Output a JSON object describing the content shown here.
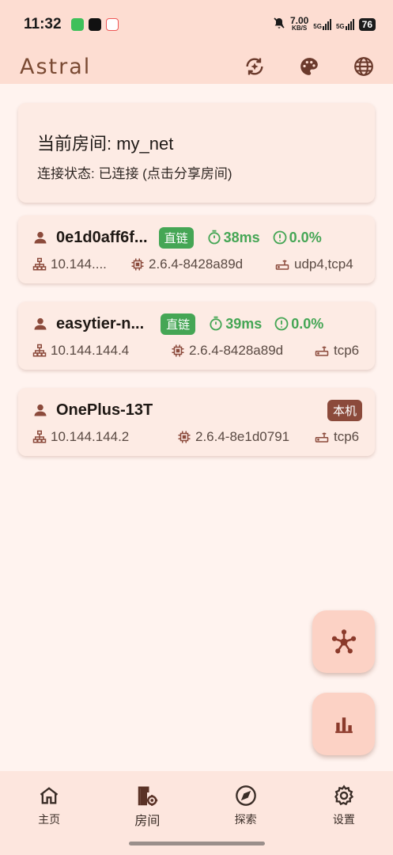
{
  "status_bar": {
    "time": "11:32",
    "net_speed_value": "7.00",
    "net_speed_unit": "KB/S",
    "signal1": "5G",
    "signal2": "5G",
    "battery": "76",
    "app_icons": [
      "wechat-icon",
      "tiktok-icon",
      "oppo-app-icon"
    ]
  },
  "app_bar": {
    "title": "Astral",
    "actions": [
      "sync-icon",
      "palette-icon",
      "globe-icon"
    ]
  },
  "room": {
    "name": "当前房间: my_net",
    "status": "连接状态: 已连接 (点击分享房间)"
  },
  "peers": [
    {
      "name": "0e1d0aff6f...",
      "badge": "直链",
      "latency": "38ms",
      "loss": "0.0%",
      "ip": "10.144....",
      "version": "2.6.4-8428a89d",
      "protocol": "udp4,tcp4"
    },
    {
      "name": "easytier-n...",
      "badge": "直链",
      "latency": "39ms",
      "loss": "0.0%",
      "ip": "10.144.144.4",
      "version": "2.6.4-8428a89d",
      "protocol": "tcp6"
    },
    {
      "name": "OnePlus-13T",
      "badge": "本机",
      "ip": "10.144.144.2",
      "version": "2.6.4-8e1d0791",
      "protocol": "tcp6"
    }
  ],
  "bottom_nav": [
    {
      "label": "主页",
      "icon": "home-icon"
    },
    {
      "label": "房间",
      "icon": "room-door-icon",
      "active": true
    },
    {
      "label": "探索",
      "icon": "compass-icon"
    },
    {
      "label": "设置",
      "icon": "gear-icon"
    }
  ],
  "colors": {
    "accent_green": "#45a655",
    "brown": "#8b4a3b",
    "header_bg": "#fdddd2",
    "page_bg": "#fff3ef"
  }
}
